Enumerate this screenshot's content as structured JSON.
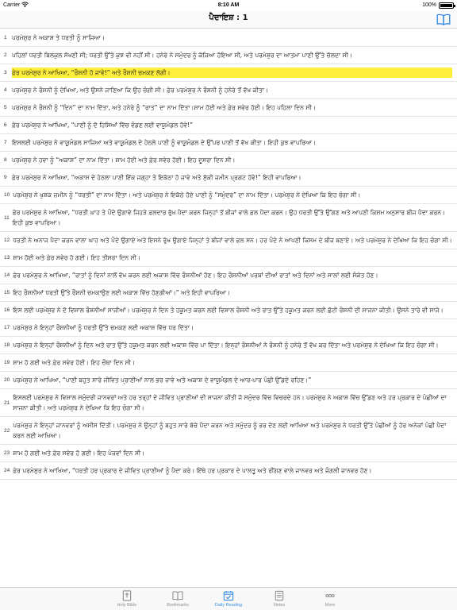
{
  "status_bar": {
    "carrier": "Carrier",
    "time": "8:10 AM",
    "battery_percent": "100%",
    "battery_level": 1.0
  },
  "nav": {
    "title": "ਪੈਦਾਇਸ਼ : 1"
  },
  "colors": {
    "highlight": "#ffee3b",
    "tab_active": "#3a8ee6",
    "tab_inactive": "#8e8e8e"
  },
  "verses": [
    {
      "num": "1",
      "text": "ਪਰਮੇਸ਼ੁਰ ਨੇ ਅਕਾਸ਼ ਤੇ ਧਰਤੀ ਨੂੰ ਸਾਜਿਆ।",
      "highlighted": false
    },
    {
      "num": "2",
      "text": "ਪਹਿਲਾਂ ਧਰਤੀ ਬਿਲਕੁਲ ਸੱਖਣੀ ਸੀ; ਧਰਤੀ ਉੱਤੇ ਕੁਝ ਵੀ ਨਹੀਂ ਸੀ। ਹਨੇਰੇ ਨੇ ਸਮੁੰਦਰ ਨੂੰ ਕੱਜਿਆ ਹੋਇਆ ਸੀ, ਅਤੇ ਪਰਮੇਸ਼ੁਰ ਦਾ ਆਤਮਾ ਪਾਣੀ ਉੱਤੇ ਚੱਲਦਾ ਸੀ।",
      "highlighted": false
    },
    {
      "num": "3",
      "text": "ਫ਼ੇਰ ਪਰਮੇਸ਼ੁਰ ਨੇ ਆਖਿਆ, “ਰੌਸ਼ਨੀ ਹੋ ਜਾਵੇ!” ਅਤੇ ਰੌਸ਼ਨੀ ਚਮਕਣ ਲੱਗੀ।",
      "highlighted": true
    },
    {
      "num": "4",
      "text": "ਪਰਮੇਸ਼ੁਰ ਨੇ ਰੌਸ਼ਨੀ ਨੂੰ ਦੇਖਿਆ, ਅਤੇ ਉਸਨੇ ਜਾਣਿਆ ਕਿ ਉਹ ਚੰਗੀ ਸੀ। ਫ਼ੇਰ ਪਰਮੇਸ਼ੁਰ ਨੇ ਰੌਸ਼ਨੀ ਨੂੰ ਹਨੇਰੇ ਤੋਂ ਵੱਖ ਕੀਤਾ।",
      "highlighted": false
    },
    {
      "num": "5",
      "text": "ਪਰਮੇਸ਼ੁਰ ਨੇ ਰੌਸ਼ਨੀ ਨੂੰ “ਦਿਨ” ਦਾ ਨਾਮ ਦਿੱਤਾ, ਅਤੇ ਹਨੇਰੇ ਨੂੰ “ਰਾਤ” ਦਾ ਨਾਮ ਦਿੱਤਾ।ਸ਼ਾਮ ਹੋਈ ਅਤੇ ਫ਼ੇਰ ਸਵੇਰ ਹੋਈ। ਇਹ ਪਹਿਲਾ ਦਿਨ ਸੀ।",
      "highlighted": false
    },
    {
      "num": "6",
      "text": "ਫ਼ੇਰ ਪਰਮੇਸ਼ੁਰ ਨੇ ਆਖਿਆ, “ਪਾਣੀ ਨੂੰ ਦੋ ਹਿਸਿਆਂ ਵਿੱਚ ਵੰਡਣ ਲਈ ਵਾਯੂਮੰਡਲ ਹੋਵੇ!”",
      "highlighted": false
    },
    {
      "num": "7",
      "text": "ਇਸਲਈ ਪਰਮੇਸ਼ੁਰ ਨੇ ਵਾਯੂਮੰਡਲ ਸਾਜਿਆ ਅਤੇ ਵਾਯੂਮੰਡਲ ਦੇ ਹੇਠਲੇ ਪਾਣੀ ਨੂੰ ਵਾਯੂਮੰਡਲ ਦੇ ਉੱਪਰ ਪਾਣੀ ਤੋਂ ਵੱਖ ਕੀਤਾ। ਇਹੀ ਕੁਝ ਵਾਪਰਿਆ।",
      "highlighted": false
    },
    {
      "num": "8",
      "text": "ਪਰਮੇਸ਼ੁਰ ਨੇ ਹਵਾ ਨੂੰ “ਅਕਾਸ਼” ਦਾ ਨਾਮ ਦਿੱਤਾ। ਸ਼ਾਮ ਹੋਈ ਅਤੇ ਫ਼ੇਰ ਸਵੇਰ ਹੋਈ। ਇਹ ਦੂਸਰਾ ਦਿਨ ਸੀ।",
      "highlighted": false
    },
    {
      "num": "9",
      "text": "ਫ਼ੇਰ ਪਰਮੇਸ਼ੁਰ ਨੇ ਆਖਿਆ, “ਅਕਾਸ਼ ਦੇ ਹੇਠਲਾ ਪਾਣੀ ਇੱਕ ਜਗ੍ਹਾ ਤੇ ਇਕੱਠਾ ਹੋ ਜਾਵੇ ਅਤੇ ਸੁੱਕੀ ਜ਼ਮੀਨ ਪ੍ਰਗਟ ਹੋਵੇ!” ਇਹੀ ਵਾਪਰਿਆ।",
      "highlighted": false
    },
    {
      "num": "10",
      "text": "ਪਰਮੇਸ਼ੁਰ ਨੇ ਖੁਸ਼ਕ ਜ਼ਮੀਨ ਨੂੰ “ਧਰਤੀ” ਦਾ ਨਾਮ ਦਿੱਤਾ। ਅਤੇ ਪਰਮੇਸ਼ੁਰ ਨੇ ਇਕੱਠੇ ਹੋਏ ਪਾਣੀ ਨੂੰ “ਸਮੁੰਦਰ” ਦਾ ਨਾਮ ਦਿੱਤਾ। ਪਰਮੇਸ਼ੁਰ ਨੇ ਦੇਖਿਆ ਕਿ ਇਹ ਚੰਗਾ ਸੀ।",
      "highlighted": false
    },
    {
      "num": "11",
      "text": "ਫ਼ੇਰ ਪਰਮੇਸ਼ੁਰ ਨੇ ਆਖਿਆ, “ਧਰਤੀ ਘਾਹ ਤੇ ਪੌਦੇ ਉਗਾਵੇ ਜਿਹੜੇ ਫ਼ਲਦਾਰ ਰੁੱਖ ਪੈਦਾ ਕਰਨ ਜਿਨ੍ਹਾਂ ਤੋਂ ਬੀਜਾਂ ਵਾਲੇ ਫ਼ਲ ਪੈਦਾ ਕਰਨ। ਉਹ ਧਰਤੀ ਉੱਤੇ ਉੱਗਣ ਅਤੇ ਆਪਣੀ ਕਿਸਮ ਅਨੁਸਾਰ ਬੀਜ ਪੈਦਾ ਕਰਨ। ਇਹੀ ਕੁਝ ਵਾਪਰਿਆ।",
      "highlighted": false
    },
    {
      "num": "12",
      "text": "ਧਰਤੀ ਨੇ ਅਨਾਜ ਪੈਦਾ ਕਰਨ ਵਾਲਾ ਘਾਹ ਅਤੇ ਪੌਦੇ ਉਗਾਏ ਅਤੇ ਇਸਨੇ ਰੁੱਖ ਉਗਾਏ ਜਿਨ੍ਹਾਂ ਤੇ ਬੀਜਾਂ ਵਾਲੇ ਫ਼ਲ ਸਨ। ਹਰ ਪੌਦੇ ਨੇ ਆਪਣੀ ਕਿਸਮ ਦੇ ਬੀਜ ਬਣਾਏ। ਅਤੇ ਪਰਮੇਸ਼ੁਰ ਨੇ ਦੇਖਿਆ ਕਿ ਇਹ ਚੰਗਾ ਸੀ।",
      "highlighted": false
    },
    {
      "num": "13",
      "text": "ਸ਼ਾਮ ਹੋਈ ਅਤੇ ਫ਼ੇਰ ਸਵੇਰ ਹੋ ਗਈ। ਇਹ ਤੀਸਰਾ ਦਿਨ ਸੀ।",
      "highlighted": false
    },
    {
      "num": "14",
      "text": "ਫ਼ੇਰ ਪਰਮੇਸ਼ੁਰ ਨੇ ਆਖਿਆ, “ਰਾਤਾਂ ਨੂੰ ਦਿਨਾਂ ਨਾਲੋਂ ਵੱਖ ਕਰਨ ਲਈ ਅਕਾਸ਼ ਵਿੱਚ ਰੌਸ਼ਨੀਆਂ ਹੋਣ। ਇਹ ਰੌਸ਼ਨੀਆਂ ਪਰਬਾਂ ਦੀਆਂ ਰਾਤਾਂ ਅਤੇ ਦਿਨਾਂ ਅਤੇ ਸਾਲਾਂ ਲਈ ਸੰਕੇਤ ਹੋਣ।",
      "highlighted": false
    },
    {
      "num": "15",
      "text": "ਇਹ ਰੌਸ਼ਨੀਆਂ ਧਰਤੀ ਉੱਤੇ ਰੌਸ਼ਨੀ ਚਮਕਾਉਣ ਲਈ ਅਕਾਸ਼ ਵਿੱਚ ਹੋਣਗੀਆਂ।” ਅਤੇ ਇਹੀ ਵਾਪਰਿਆ।",
      "highlighted": false
    },
    {
      "num": "16",
      "text": "ਇਸ ਲਈ ਪਰਮੇਸ਼ੁਰ ਨੇ ਦੋ ਵਿਸ਼ਾਲ ਰੌਸ਼ਨੀਆਂ ਸਾਜੀਆਂ। ਪਰਮੇਸ਼ੁਰ ਨੇ ਦਿਨ ਤੇ ਹਕੂਮਤ ਕਰਨ ਲਈ ਵਿਸ਼ਾਲ ਰੌਸ਼ਨੀ ਅਤੇ ਰਾਤ ਉੱਤੇ ਹਕੂਮਤ ਕਰਨ ਲਈ ਛੋਟੀ ਰੌਸ਼ਨੀ ਦੀ ਸਾਜਨਾ ਕੀਤੀ। ਉਸਨੇ ਤਾਰੇ ਵੀ ਸਾਜੇ।",
      "highlighted": false
    },
    {
      "num": "17",
      "text": "ਪਰਮੇਸ਼ੁਰ ਨੇ ਇਨ੍ਹਾਂ ਰੌਸ਼ਨੀਆਂ ਨੂੰ ਧਰਤੀ ਉੱਤੇ ਚਮਕਣ ਲਈ ਅਕਾਸ਼ ਵਿੱਚ ਧਰ ਦਿੱਤਾ।",
      "highlighted": false
    },
    {
      "num": "18",
      "text": "ਪਰਮੇਸ਼ੁਰ ਨੇ ਇਨ੍ਹਾਂ ਰੌਸ਼ਨੀਆਂ ਨੂੰ ਦਿਨ ਅਤੇ ਰਾਤ ਉੱਤੇ ਹਕੂਮਤ ਕਰਨ ਲਈ ਅਕਾਸ਼ ਵਿੱਚ ਪਾ ਦਿੱਤਾ। ਇਨ੍ਹਾਂ ਰੌਸ਼ਨੀਆਂ ਨੇ ਰੌਸ਼ਨੀ ਨੂੰ ਹਨੇਰੇ ਤੋਂ ਵੱਖ ਕਰ ਦਿੱਤਾ ਅਤੇ ਪਰਮੇਸ਼ੁਰ ਨੇ ਦੇਖਿਆ ਕਿ ਇਹ ਚੰਗਾ ਸੀ।",
      "highlighted": false
    },
    {
      "num": "19",
      "text": "ਸ਼ਾਮ ਹੋ ਗਈ ਅਤੇ ਫ਼ੇਰ ਸਵੇਰ ਹੋਈ। ਇਹ ਚੌਥਾ ਦਿਨ ਸੀ।",
      "highlighted": false
    },
    {
      "num": "20",
      "text": "ਪਰਮੇਸ਼ੁਰ ਨੇ ਆਖਿਆ, “ਪਾਣੀ ਬਹੁਤ ਸਾਰੇ ਜੀਵਿਤ ਪ੍ਰਾਣੀਆਂ ਨਾਲ ਭਰ ਜਾਵੇ ਅਤੇ ਅਕਾਸ਼ ਦੇ ਵਾਯੂਮੰਡਲ ਦੇ ਆਰ-ਪਾਰ ਪੰਛੀ ਉੱਡਦੇ ਰਹਿਣ।”",
      "highlighted": false
    },
    {
      "num": "21",
      "text": "ਇਸਲਈ ਪਰਮੇਸ਼ੁਰ ਨੇ ਵਿਸ਼ਾਲ ਸਮੁੰਦਰੀ ਜਾਨਵਰਾਂ ਅਤੇ ਹਰ ਤਰ੍ਹਾਂ ਦੇ ਜੀਵਿਤ ਪ੍ਰਾਣੀਆਂ ਦੀ ਸਾਜਨਾ ਕੀਤੀ ਜੋ ਸਮੁੰਦਰ ਵਿੱਚ ਵਿਚਰਦੇ ਹਨ। ਪਰਮੇਸ਼ੁਰ ਨੇ ਅਕਾਸ਼ ਵਿੱਚ ਉੱਡਣ ਅਤੇ ਹਰ ਪ੍ਰਕਾਰ ਦੇ ਪੰਛੀਆਂ ਦਾ ਸਾਜਨਾ ਕੀਤੀ। ਅਤੇ ਪਰਮੇਸ਼ੁਰ ਨੇ ਦੇਖਿਆ ਕਿ ਇਹ ਚੰਗਾ ਸੀ।",
      "highlighted": false
    },
    {
      "num": "22",
      "text": "ਪਰਮੇਸ਼ੁਰ ਨੇ ਇਨ੍ਹਾਂ ਜਾਨਵਰਾਂ ਨੂੰ ਅਸੀਸ ਦਿੱਤੀ। ਪਰਮੇਸ਼ੁਰ ਨੇ ਉਨ੍ਹਾਂ ਨੂੰ ਬਹੁਤ ਸਾਰੇ ਬੱਚੇ ਪੈਦਾ ਕਰਨ ਅਤੇ ਸਮੁੰਦਰ ਨੂੰ ਭਰ ਦੇਣ ਲਈ ਆਖਿਆ ਅਤੇ ਪਰਮੇਸ਼ੁਰ ਨੇ ਧਰਤੀ ਉੱਤੇ ਪੰਛੀਆਂ ਨੂੰ ਹੋਰ ਅਨੇਕਾਂ ਪੰਛੀ ਪੈਦਾ ਕਰਨ ਲਈ ਆਖਿਆ।",
      "highlighted": false
    },
    {
      "num": "23",
      "text": "ਸ਼ਾਮ ਹੋ ਗਈ ਅਤੇ ਫ਼ੇਰ ਸਵੇਰ ਹੋ ਗਈ। ਇਹ ਪੰਜਵਾਂ ਦਿਨ ਸੀ।",
      "highlighted": false
    },
    {
      "num": "24",
      "text": "ਫ਼ੇਰ ਪਰਮੇਸ਼ੁਰ ਨੇ ਆਖਿਆ, “ਧਰਤੀ ਹਰ ਪ੍ਰਕਾਰ ਦੇ ਜੀਵਿਤ ਪ੍ਰਾਣੀਆਂ ਨੂੰ ਪੈਦਾ ਕਰੇ। ਇੱਥੇ ਹਰ ਪ੍ਰਕਾਰ ਦੇ ਪਾਲਤੂ ਅਤੇ ਰੀਂਗਣ ਵਾਲੇ ਜਾਨਵਰ ਅਤੇ ਜੰਗਲੀ ਜਾਨਵਰ ਹੋਣ।",
      "highlighted": false
    }
  ],
  "tabs": [
    {
      "id": "holy-bible",
      "label": "Holy Bible",
      "icon": "bible-icon",
      "active": false
    },
    {
      "id": "bookmarks",
      "label": "Bookmarks",
      "icon": "bookmarks-icon",
      "active": false
    },
    {
      "id": "daily-reading",
      "label": "Daily Reading",
      "icon": "calendar-check-icon",
      "active": true
    },
    {
      "id": "notes",
      "label": "Notes",
      "icon": "notes-icon",
      "active": false
    },
    {
      "id": "more",
      "label": "More",
      "icon": "more-icon",
      "active": false
    }
  ]
}
